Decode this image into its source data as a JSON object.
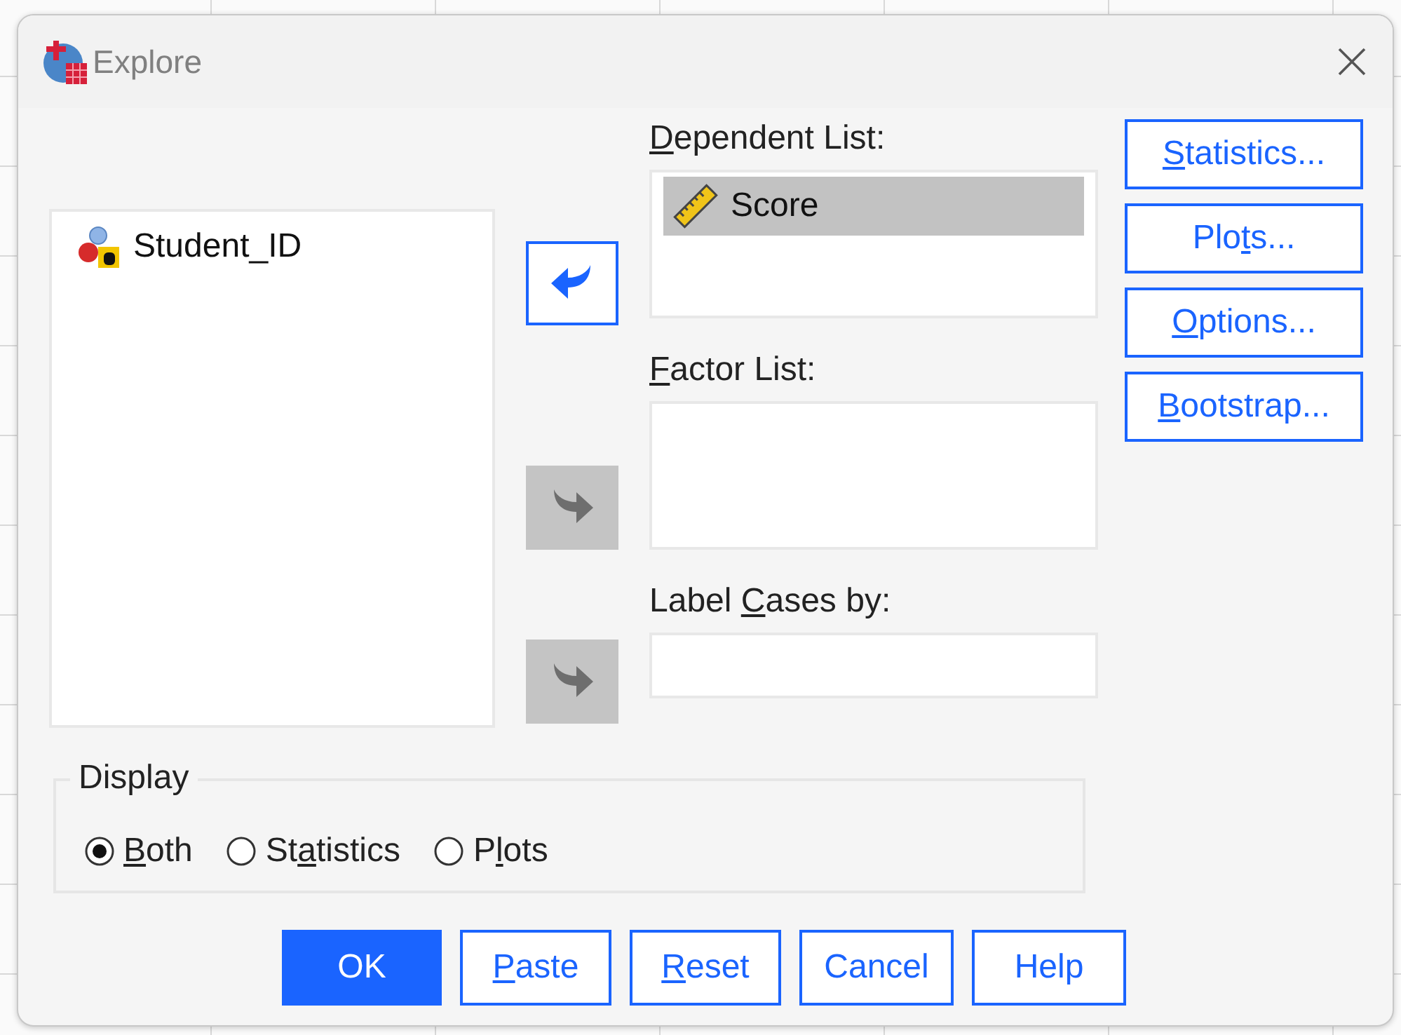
{
  "window": {
    "title": "Explore"
  },
  "source_list": {
    "items": [
      {
        "label": "Student_ID",
        "kind": "nominal",
        "selected": false
      }
    ]
  },
  "move_buttons": [
    {
      "kind": "remove",
      "disabled": false
    },
    {
      "kind": "add",
      "disabled": true
    },
    {
      "kind": "add",
      "disabled": true
    }
  ],
  "targets": [
    {
      "kind": "list",
      "label": {
        "key": "D",
        "after": "ependent List:"
      },
      "items": [
        {
          "label": "Score",
          "kind": "scale",
          "selected": true
        }
      ]
    },
    {
      "kind": "list",
      "label": {
        "key": "F",
        "after": "actor List:"
      }
    },
    {
      "kind": "field",
      "label": {
        "before": "Label ",
        "key": "C",
        "after": "ases by:"
      }
    }
  ],
  "side_buttons": [
    {
      "key": "S",
      "after": "tatistics..."
    },
    {
      "before": "Plo",
      "key": "t",
      "after": "s..."
    },
    {
      "key": "O",
      "after": "ptions..."
    },
    {
      "key": "B",
      "after": "ootstrap..."
    }
  ],
  "display": {
    "legend": "Display",
    "options": [
      {
        "label": {
          "key": "B",
          "after": "oth"
        },
        "selected": true
      },
      {
        "label": {
          "before": "St",
          "key": "a",
          "after": "tistics"
        },
        "selected": false
      },
      {
        "label": {
          "before": "P",
          "key": "l",
          "after": "ots"
        },
        "selected": false
      }
    ]
  },
  "buttons": [
    {
      "label": {
        "after": "OK"
      },
      "default": true
    },
    {
      "label": {
        "key": "P",
        "after": "aste"
      },
      "default": false
    },
    {
      "label": {
        "key": "R",
        "after": "eset"
      },
      "default": false
    },
    {
      "label": {
        "after": "Cancel"
      },
      "default": false
    },
    {
      "label": {
        "after": "Help"
      },
      "default": false
    }
  ]
}
